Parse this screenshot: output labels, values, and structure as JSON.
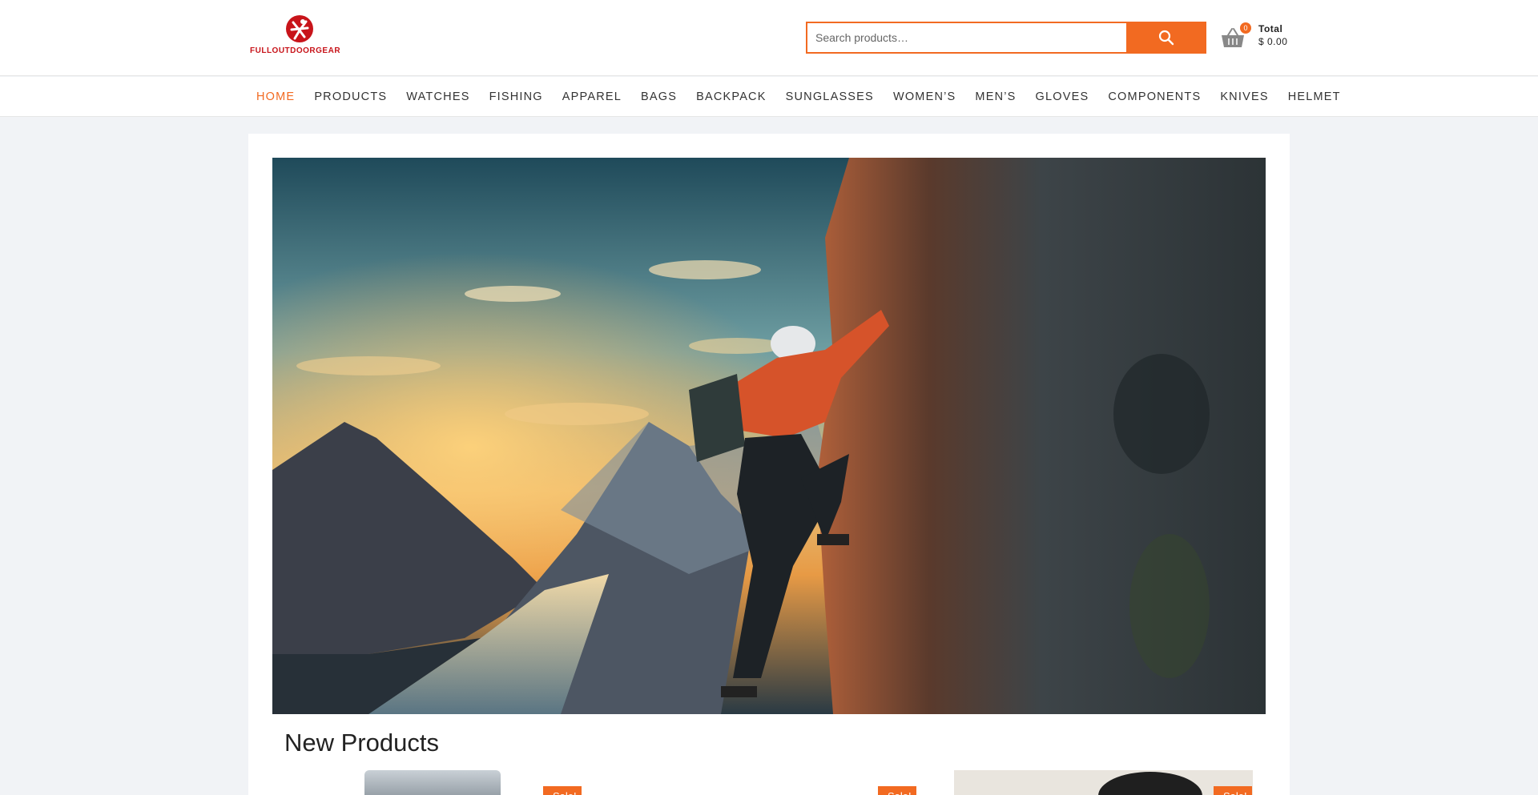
{
  "brand": {
    "name": "FULLOUTDOORGEAR",
    "color": "#c8141a"
  },
  "search": {
    "placeholder": "Search products…",
    "icon": "search-icon"
  },
  "cart": {
    "count": "0",
    "total_label": "Total",
    "total_value": "$ 0.00",
    "icon": "basket-icon"
  },
  "nav": {
    "items": [
      {
        "label": "HOME",
        "active": true
      },
      {
        "label": "PRODUCTS"
      },
      {
        "label": "WATCHES"
      },
      {
        "label": "FISHING"
      },
      {
        "label": "APPAREL"
      },
      {
        "label": "BAGS"
      },
      {
        "label": "BACKPACK"
      },
      {
        "label": "SUNGLASSES"
      },
      {
        "label": "WOMEN’S"
      },
      {
        "label": "MEN’S"
      },
      {
        "label": "GLOVES"
      },
      {
        "label": "COMPONENTS"
      },
      {
        "label": "KNIVES"
      },
      {
        "label": "HELMET"
      }
    ]
  },
  "hero": {
    "image": "climber-on-cliff-above-fjord-at-sunset"
  },
  "sections": {
    "new_products_title": "New Products"
  },
  "products": [
    {
      "image": "product-1"
    },
    {
      "badge": "Sale!"
    },
    {
      "badge": "Sale!"
    },
    {
      "image": "product-3",
      "badge": "Sale!"
    }
  ],
  "colors": {
    "accent": "#f26a21",
    "background": "#f1f3f6"
  }
}
